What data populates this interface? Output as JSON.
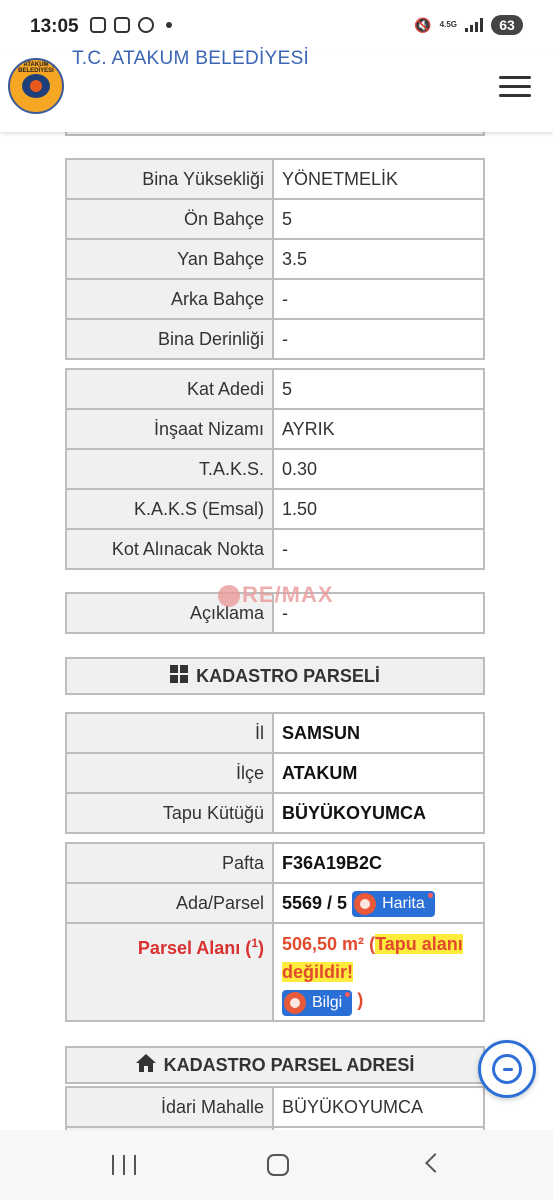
{
  "status_bar": {
    "time": "13:05",
    "network": "4.5G",
    "battery": "63"
  },
  "header": {
    "title": "T.C. ATAKUM BELEDİYESİ",
    "logo_text": "ATAKUM BELEDİYESİ"
  },
  "table_yapi": [
    {
      "label": "Bina Yüksekliği",
      "value": "YÖNETMELİK"
    },
    {
      "label": "Ön Bahçe",
      "value": "5"
    },
    {
      "label": "Yan Bahçe",
      "value": "3.5"
    },
    {
      "label": "Arka Bahçe",
      "value": "-"
    },
    {
      "label": "Bina Derinliği",
      "value": "-"
    }
  ],
  "table_kat": [
    {
      "label": "Kat Adedi",
      "value": "5"
    },
    {
      "label": "İnşaat Nizamı",
      "value": "AYRIK"
    },
    {
      "label": "T.A.K.S.",
      "value": "0.30"
    },
    {
      "label": "K.A.K.S (Emsal)",
      "value": "1.50"
    },
    {
      "label": "Kot Alınacak Nokta",
      "value": "-"
    }
  ],
  "aciklama": {
    "label": "Açıklama",
    "value": "-"
  },
  "watermark": "RE/MAX",
  "kadastro": {
    "title": "KADASTRO PARSELİ",
    "il_label": "İl",
    "il_value": "SAMSUN",
    "ilce_label": "İlçe",
    "ilce_value": "ATAKUM",
    "tapu_label": "Tapu Kütüğü",
    "tapu_value": "BÜYÜKOYUMCA",
    "pafta_label": "Pafta",
    "pafta_value": "F36A19B2C",
    "ada_label": "Ada/Parsel",
    "ada_value": "5569 / 5",
    "harita_button": "Harita",
    "alan_label": "Parsel Alanı (",
    "alan_sup": "1",
    "alan_label_end": ")",
    "alan_value": "506,50 m²",
    "alan_paren_open": " (",
    "alan_note": "Tapu alanı değildir!",
    "bilgi_button": "Bilgi",
    "alan_paren_close": " )"
  },
  "adres": {
    "title": "KADASTRO PARSEL ADRESİ",
    "mahalle_label": "İdari Mahalle",
    "mahalle_value": "BÜYÜKOYUMCA"
  },
  "colors": {
    "brand_blue": "#3a66b5",
    "button_blue": "#2a6fd6",
    "alert_red": "#e24a2e",
    "highlight_yellow": "#ffeb3b"
  }
}
